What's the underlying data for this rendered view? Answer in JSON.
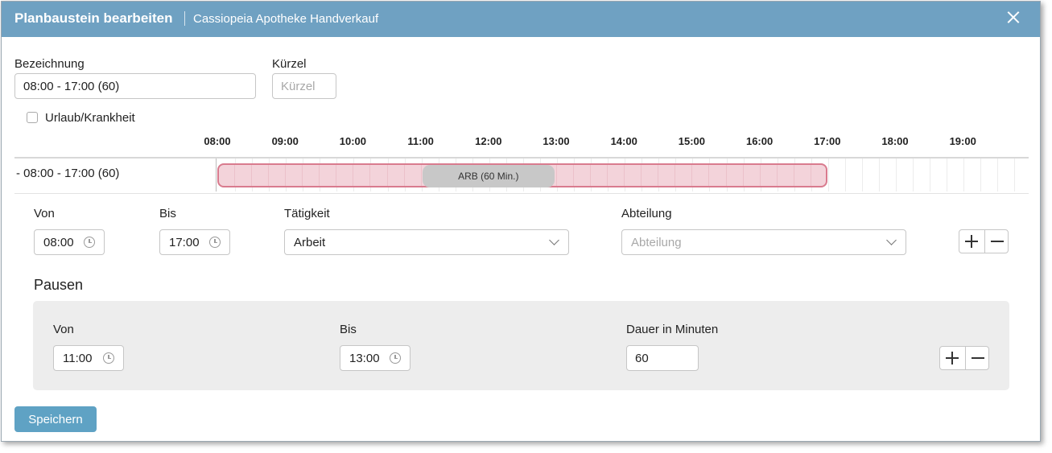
{
  "dialog": {
    "title": "Planbaustein bearbeiten",
    "subtitle": "Cassiopeia Apotheke Handverkauf"
  },
  "form": {
    "bezeichnung_label": "Bezeichnung",
    "bezeichnung_value": "08:00 - 17:00 (60)",
    "kuerzel_label": "Kürzel",
    "kuerzel_placeholder": "Kürzel",
    "urlaub_label": "Urlaub/Krankheit",
    "urlaub_checked": false
  },
  "timeline": {
    "hours": [
      "08:00",
      "09:00",
      "10:00",
      "11:00",
      "12:00",
      "13:00",
      "14:00",
      "15:00",
      "16:00",
      "17:00",
      "18:00",
      "19:00"
    ],
    "row_label": "- 08:00 - 17:00 (60)",
    "shift": {
      "start": "08:00",
      "end": "17:00",
      "color": "#f3d3da",
      "border_color": "#d97b8e"
    },
    "break": {
      "start": "11:00",
      "end": "13:00",
      "label": "ARB (60 Min.)"
    }
  },
  "activity": {
    "von_label": "Von",
    "von_value": "08:00",
    "bis_label": "Bis",
    "bis_value": "17:00",
    "taetigkeit_label": "Tätigkeit",
    "taetigkeit_value": "Arbeit",
    "abteilung_label": "Abteilung",
    "abteilung_placeholder": "Abteilung"
  },
  "pausen": {
    "title": "Pausen",
    "von_label": "Von",
    "von_value": "11:00",
    "bis_label": "Bis",
    "bis_value": "13:00",
    "dauer_label": "Dauer in Minuten",
    "dauer_value": "60"
  },
  "actions": {
    "save_label": "Speichern",
    "save_color": "#5fa2c4"
  },
  "theme": {
    "titlebar_color": "#6fa1c2"
  }
}
